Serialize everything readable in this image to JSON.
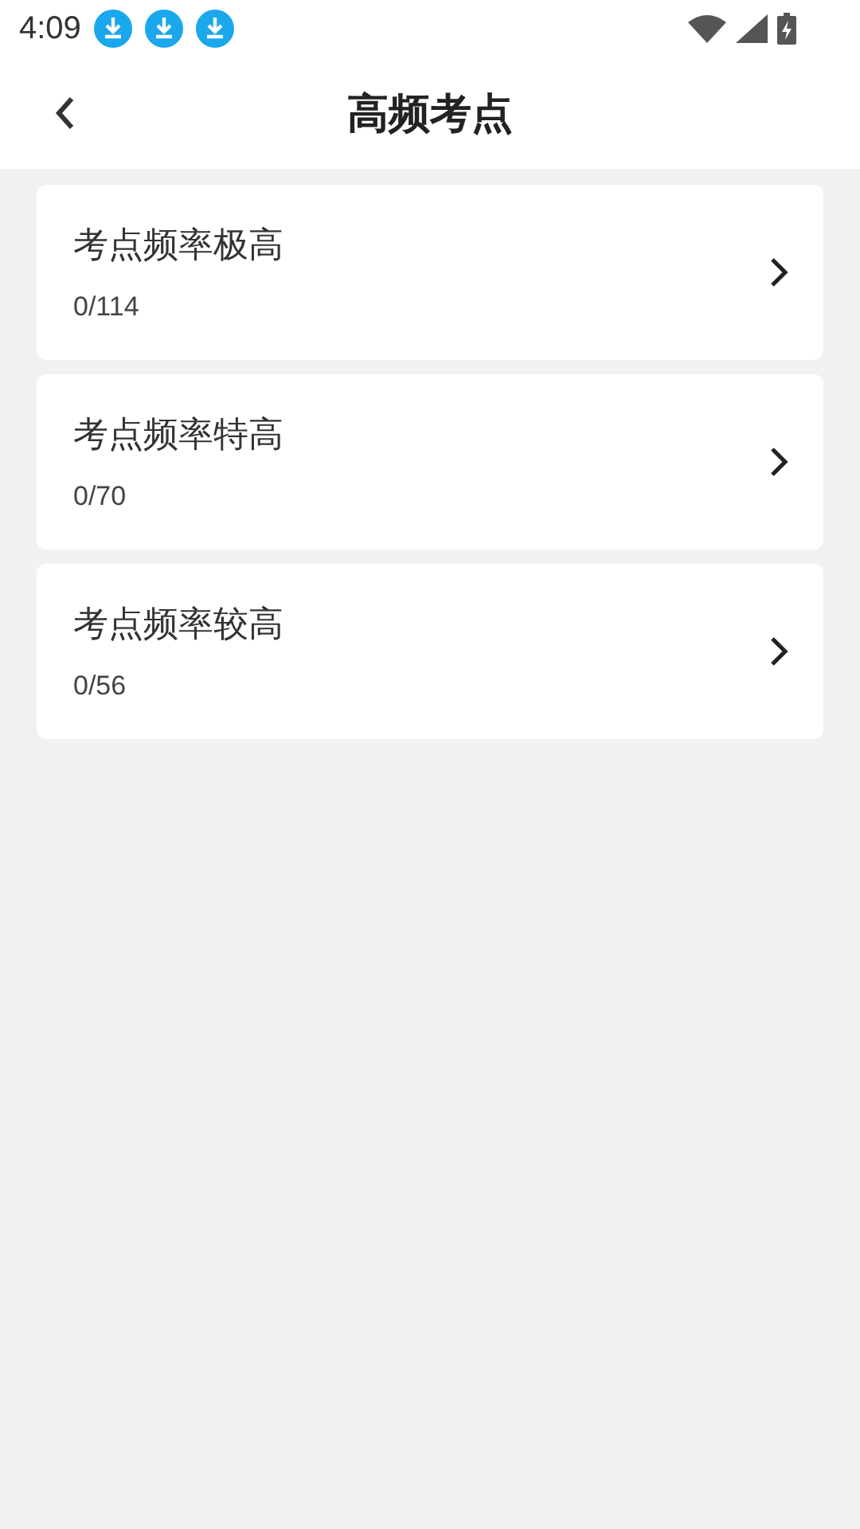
{
  "status_bar": {
    "time": "4:09",
    "notifications": [
      {
        "kind": "download"
      },
      {
        "kind": "download"
      },
      {
        "kind": "download"
      }
    ]
  },
  "header": {
    "title": "高频考点"
  },
  "items": [
    {
      "title": "考点频率极高",
      "progress": "0/114"
    },
    {
      "title": "考点频率特高",
      "progress": "0/70"
    },
    {
      "title": "考点频率较高",
      "progress": "0/56"
    }
  ]
}
